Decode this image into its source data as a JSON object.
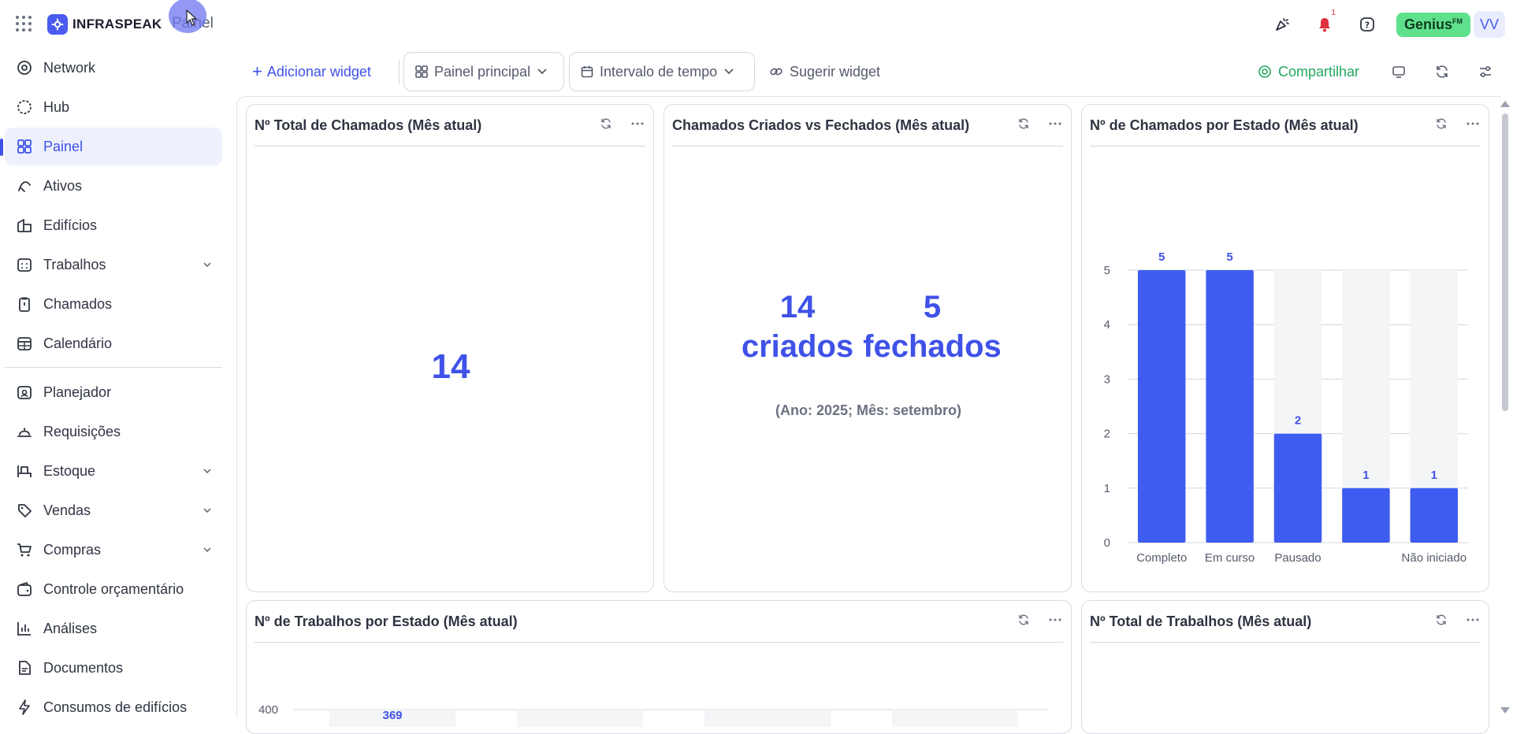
{
  "brand": {
    "name": "INFRASPEAK"
  },
  "breadcrumb": "Painel",
  "topbar": {
    "notifications_count": "1",
    "genius_label": "Genius",
    "genius_sup": "FM",
    "avatar_initials": "VV"
  },
  "sidebar": {
    "items": [
      {
        "label": "Network",
        "icon": "network-icon"
      },
      {
        "label": "Hub",
        "icon": "hub-icon"
      },
      {
        "label": "Painel",
        "icon": "dashboard-icon",
        "active": true
      },
      {
        "label": "Ativos",
        "icon": "assets-icon"
      },
      {
        "label": "Edifícios",
        "icon": "building-icon"
      },
      {
        "label": "Trabalhos",
        "icon": "calendar-grid-icon",
        "chevron": true
      },
      {
        "label": "Chamados",
        "icon": "clipboard-icon"
      },
      {
        "label": "Calendário",
        "icon": "calendar-icon"
      },
      {
        "label": "Planejador",
        "icon": "planner-icon"
      },
      {
        "label": "Requisições",
        "icon": "bell-service-icon"
      },
      {
        "label": "Estoque",
        "icon": "stock-icon",
        "chevron": true
      },
      {
        "label": "Vendas",
        "icon": "tag-icon",
        "chevron": true
      },
      {
        "label": "Compras",
        "icon": "cart-icon",
        "chevron": true
      },
      {
        "label": "Controle orçamentário",
        "icon": "wallet-icon"
      },
      {
        "label": "Análises",
        "icon": "chart-icon"
      },
      {
        "label": "Documentos",
        "icon": "document-icon"
      },
      {
        "label": "Consumos de edifícios",
        "icon": "bolt-icon"
      }
    ]
  },
  "toolbar": {
    "add_widget": "Adicionar widget",
    "dashboard_select": "Painel principal",
    "time_range_select": "Intervalo de tempo",
    "suggest_widget": "Sugerir widget",
    "share": "Compartilhar"
  },
  "widgets": {
    "total_tickets": {
      "title": "Nº Total de Chamados (Mês atual)",
      "value": "14"
    },
    "created_vs_closed": {
      "title": "Chamados Criados vs Fechados (Mês atual)",
      "created_value": "14",
      "created_label": "criados",
      "closed_value": "5",
      "closed_label": "fechados",
      "period": "(Ano: 2025; Mês: setembro)"
    },
    "tickets_by_state": {
      "title": "Nº de Chamados por Estado (Mês atual)"
    },
    "jobs_by_state": {
      "title": "Nº de Trabalhos por Estado (Mês atual)"
    },
    "total_jobs": {
      "title": "Nº Total de Trabalhos (Mês atual)"
    }
  },
  "chart_data": [
    {
      "type": "bar",
      "title": "Nº de Chamados por Estado (Mês atual)",
      "categories": [
        "Completo",
        "Em curso",
        "Pausado",
        "",
        "Não iniciado"
      ],
      "values": [
        5,
        5,
        2,
        1,
        1
      ],
      "ylim": [
        0,
        5
      ],
      "yticks": [
        0,
        1,
        2,
        3,
        4,
        5
      ],
      "xlabel": "",
      "ylabel": "",
      "bar_color": "#3f5cf0",
      "track_color": "#f4f5f7",
      "grid": true
    },
    {
      "type": "bar",
      "title": "Nº de Trabalhos por Estado (Mês atual)",
      "categories": [],
      "values": [
        369
      ],
      "yticks": [
        400
      ],
      "partial": true
    }
  ],
  "colors": {
    "accent": "#3f52e8",
    "share": "#22a861",
    "genius": "#5fe08d",
    "alert": "#e0303d"
  }
}
